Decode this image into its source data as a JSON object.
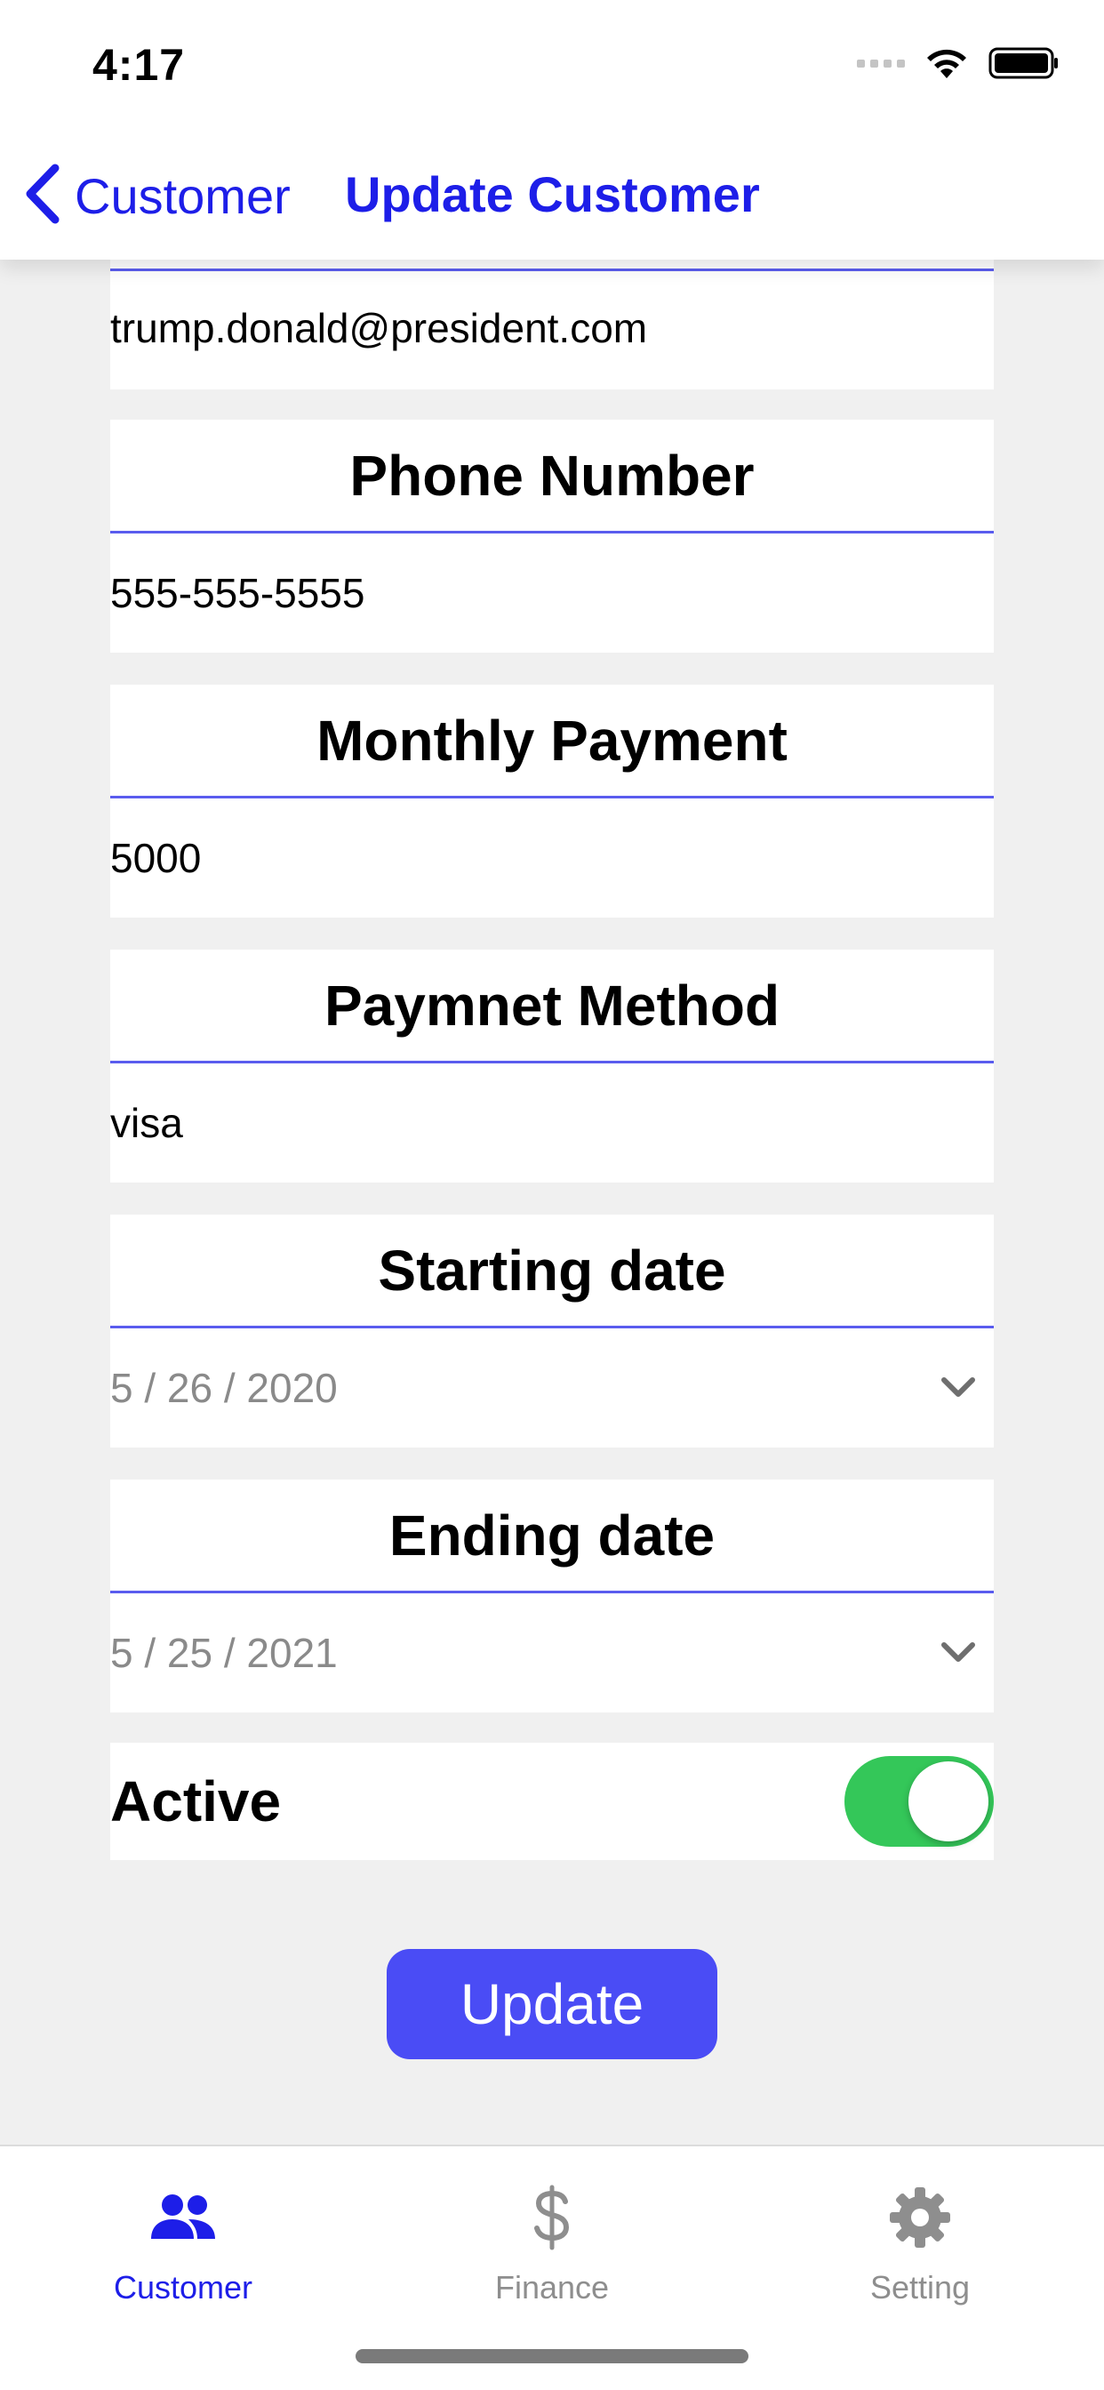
{
  "status_bar": {
    "time": "4:17"
  },
  "nav": {
    "back_label": "Customer",
    "title": "Update Customer"
  },
  "email": {
    "value": "trump.donald@president.com"
  },
  "fields": {
    "phone": {
      "label": "Phone Number",
      "value": "555-555-5555"
    },
    "monthly_payment": {
      "label": "Monthly Payment",
      "value": "5000"
    },
    "payment_method": {
      "label": "Paymnet Method",
      "value": "visa"
    },
    "starting_date": {
      "label": "Starting date",
      "value": "5 / 26 / 2020"
    },
    "ending_date": {
      "label": "Ending date",
      "value": "5 / 25 / 2021"
    }
  },
  "active": {
    "label": "Active",
    "on": true
  },
  "update_button": {
    "label": "Update",
    "color": "#4a4cf5"
  },
  "tabs": [
    {
      "label": "Customer",
      "icon": "people-icon",
      "active": true
    },
    {
      "label": "Finance",
      "icon": "dollar-icon",
      "active": false
    },
    {
      "label": "Setting",
      "icon": "gear-icon",
      "active": false
    }
  ],
  "colors": {
    "accent": "#1d1ee8",
    "divider": "#5a5cee",
    "toggle_on": "#34c759"
  }
}
